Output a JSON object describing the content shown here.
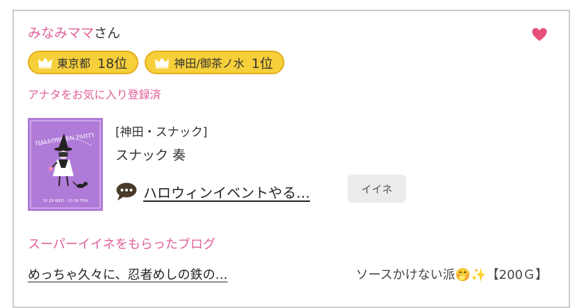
{
  "user": {
    "name": "みなみママ",
    "suffix": "さん"
  },
  "favorite_icon": "heart-icon",
  "badges": [
    {
      "icon": "crown-icon",
      "area": "東京都",
      "rank": "18位"
    },
    {
      "icon": "crown-icon",
      "area": "神田/御茶ノ水",
      "rank": "1位"
    }
  ],
  "fav_status": "アナタをお気に入り登録済",
  "shop": {
    "category": "[神田・スナック]",
    "name": "スナック 奏",
    "thumbnail_text": {
      "title": "HALLOWEEN PARTY",
      "dates": "10.29 WED - 10.30 THU"
    }
  },
  "post": {
    "icon": "chat-bubble-icon",
    "title": "ハロウィンイベントやる…",
    "like_label": "イイネ"
  },
  "super_iine_heading": "スーパーイイネをもらったブログ",
  "blog": {
    "title": "めっちゃ久々に、忍者めしの鉄の…",
    "comment": "ソースかけない派🤭✨",
    "reward": "【200Ｇ】"
  },
  "colors": {
    "accent_pink": "#e0609a",
    "badge_yellow": "#f7cf3a",
    "badge_border": "#e3ac18",
    "thumb_purple": "#b07ad8",
    "heart": "#e8507a"
  }
}
